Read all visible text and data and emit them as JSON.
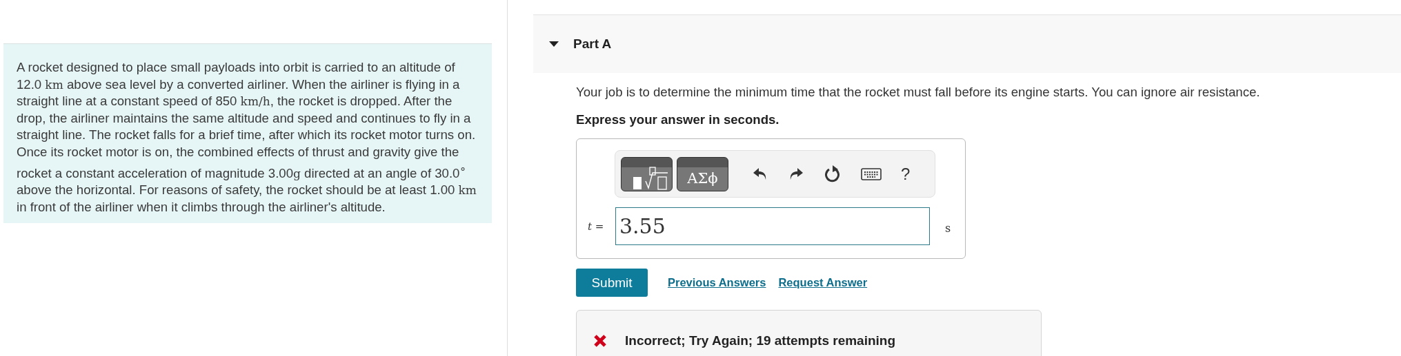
{
  "problem": {
    "segments": [
      {
        "kind": "text",
        "text": "A rocket designed to place small payloads into orbit is carried to an altitude of 12.0 "
      },
      {
        "kind": "math",
        "text": "km"
      },
      {
        "kind": "text",
        "text": " above sea level by a converted airliner. When the airliner is flying in a straight line at a constant speed of 850 "
      },
      {
        "kind": "math",
        "text": "km/h"
      },
      {
        "kind": "text",
        "text": ", the rocket is dropped. After the drop, the airliner maintains the same altitude and speed and continues to fly in a straight line. The rocket falls for a brief time, after which its rocket motor turns on. Once its rocket motor is on, the combined effects of thrust and gravity give the rocket a constant acceleration of magnitude 3.00"
      },
      {
        "kind": "math",
        "text": "g"
      },
      {
        "kind": "text",
        "text": " directed at an angle of 30.0$^{∘}$ above the horizontal. For reasons of safety, the rocket should be at least 1.00 "
      },
      {
        "kind": "math",
        "text": "km"
      },
      {
        "kind": "text",
        "text": " in front of the airliner when it climbs through the airliner's altitude."
      }
    ]
  },
  "part": {
    "title": "Part A",
    "expanded": true,
    "question": "Your job is to determine the minimum time that the rocket must fall before its engine starts. You can ignore air resistance.",
    "instruction": "Express your answer in seconds.",
    "toolbar": [
      {
        "kind": "templates"
      },
      {
        "kind": "symbols",
        "text": "ΑΣϕ"
      },
      {
        "kind": "undo"
      },
      {
        "kind": "redo"
      },
      {
        "kind": "reset"
      },
      {
        "kind": "keyboard"
      },
      {
        "kind": "help",
        "text": "?"
      }
    ],
    "variable": "t",
    "equals": "=",
    "value": "3.55",
    "unit": "s",
    "submit": "Submit",
    "links": [
      "Previous Answers",
      "Request Answer"
    ],
    "feedback": {
      "kind": "incorrect",
      "text": "Incorrect; Try Again; 19 attempts remaining"
    }
  }
}
